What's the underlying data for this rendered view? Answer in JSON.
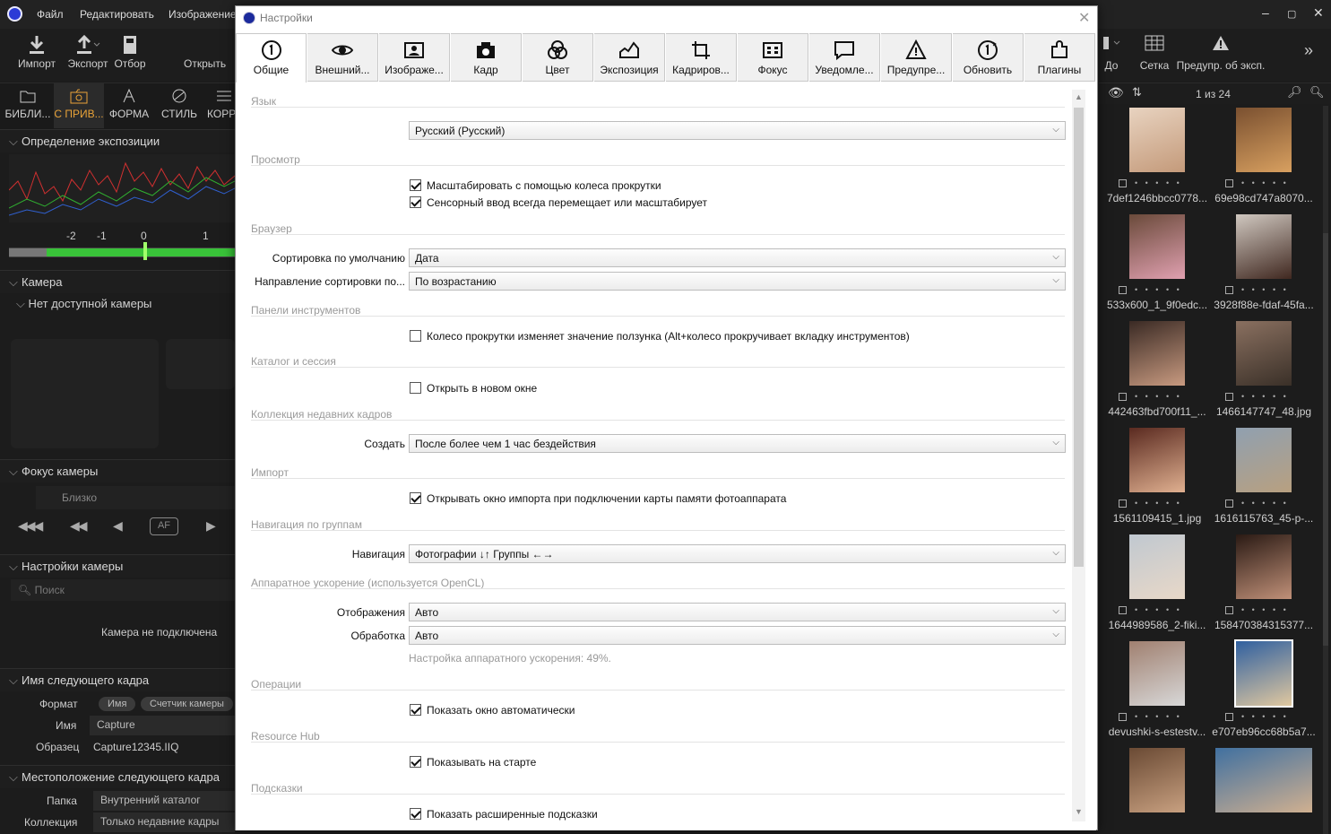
{
  "app": {
    "menu": [
      "Файл",
      "Редактировать",
      "Изображение"
    ],
    "toolbar": {
      "import": "Импорт",
      "export": "Экспорт",
      "cull": "Отбор",
      "open": "Открыть"
    },
    "tool_tabs": [
      "БИБЛИ...",
      "С ПРИВ...",
      "ФОРМА",
      "СТИЛЬ",
      "КОРР"
    ],
    "sections": {
      "exposure": "Определение экспозиции",
      "camera": "Камера",
      "no_camera": "Нет доступной камеры",
      "focus": "Фокус камеры",
      "focus_near": "Близко",
      "focus_af": "AF",
      "camera_settings": "Настройки камеры",
      "search_placeholder": "Поиск",
      "camera_not_connected": "Камера не подключена",
      "next_name": "Имя следующего кадра",
      "format_label": "Формат",
      "format_pill1": "Имя",
      "format_pill2": "Счетчик камеры",
      "name_label": "Имя",
      "name_value": "Capture",
      "sample_label": "Образец",
      "sample_value": "Capture12345.IIQ",
      "location": "Местоположение следующего кадра",
      "folder_label": "Папка",
      "folder_value": "Внутренний каталог",
      "collection_label": "Коллекция",
      "collection_value": "Только недавние кадры"
    },
    "exposure_scale": [
      "-2",
      "-1",
      "0",
      "1"
    ]
  },
  "right_panel": {
    "toolbar": {
      "before": "До",
      "grid": "Сетка",
      "warn": "Предупр. об эксп."
    },
    "counter": "1 из 24",
    "thumbnails": [
      "7def1246bbcc0778...",
      "69e98cd747a8070...",
      "533x600_1_9f0edc...",
      "3928f88e-fdaf-45fa...",
      "442463fbd700f11_...",
      "1466147747_48.jpg",
      "1561109415_1.jpg",
      "1616115763_45-p-...",
      "1644989586_2-fiki...",
      "158470384315377...",
      "devushki-s-estestv...",
      "e707eb96cc68b5a7..."
    ]
  },
  "dialog": {
    "title": "Настройки",
    "tabs": [
      "Общие",
      "Внешний...",
      "Изображе...",
      "Кадр",
      "Цвет",
      "Экспозиция",
      "Кадриров...",
      "Фокус",
      "Уведомле...",
      "Предупре...",
      "Обновить",
      "Плагины"
    ],
    "groups": {
      "language": "Язык",
      "view": "Просмотр",
      "browser": "Браузер",
      "toolbars": "Панели инструментов",
      "catalog": "Каталог и сессия",
      "recent": "Коллекция недавних кадров",
      "import": "Импорт",
      "group_nav": "Навигация по группам",
      "hw": "Аппаратное ускорение (используется OpenCL)",
      "ops": "Операции",
      "hub": "Resource Hub",
      "tips": "Подсказки"
    },
    "language_value": "Русский (Русский)",
    "view_cb1": "Масштабировать с помощью колеса прокрутки",
    "view_cb2": "Сенсорный ввод всегда перемещает или масштабирует",
    "sort_label": "Сортировка по умолчанию",
    "sort_value": "Дата",
    "sort_dir_label": "Направление сортировки по...",
    "sort_dir_value": "По возрастанию",
    "toolbar_cb": "Колесо прокрутки изменяет значение ползунка (Alt+колесо прокручивает вкладку инструментов)",
    "catalog_cb": "Открыть в новом окне",
    "create_label": "Создать",
    "create_value": "После более чем 1 час бездействия",
    "import_cb": "Открывать окно импорта при подключении карты памяти фотоаппарата",
    "nav_label": "Навигация",
    "nav_value": "Фотографии ↓↑ Группы ←→",
    "display_label": "Отображения",
    "display_value": "Авто",
    "processing_label": "Обработка",
    "processing_value": "Авто",
    "hw_hint": "Настройка аппаратного ускорения: 49%.",
    "ops_cb": "Показать окно автоматически",
    "hub_cb": "Показывать на старте",
    "tips_cb": "Показать расширенные подсказки"
  }
}
